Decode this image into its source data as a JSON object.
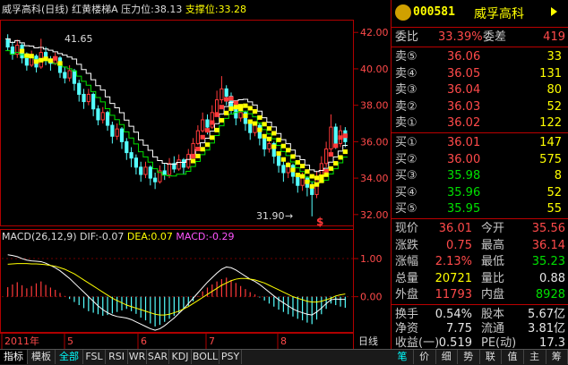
{
  "stock": {
    "name": "威孚高科",
    "period": "日线",
    "indicator_name": "红黄楼梯A",
    "pressure_label": "压力位",
    "pressure_value": "38.13",
    "support_label": "支撑位",
    "support_value": "33.28",
    "code": "000581",
    "title_name": "威孚高科"
  },
  "chart_data": {
    "type": "candlestick",
    "price_axis_ticks": [
      "42.00",
      "40.00",
      "38.00",
      "36.00",
      "34.00",
      "32.00"
    ],
    "ylim": [
      31.5,
      42.6
    ],
    "high_label": "41.65",
    "low_label": "31.90",
    "low_label_arrow": "→",
    "x_labels": [
      "2011年",
      "5",
      "6",
      "7",
      "8"
    ],
    "period_label": "日线",
    "candles": [
      [
        41.6,
        41.2,
        41.9,
        41.0
      ],
      [
        41.2,
        40.8,
        41.5,
        40.5
      ],
      [
        40.8,
        41.3,
        41.6,
        40.6
      ],
      [
        41.3,
        40.6,
        41.4,
        40.3
      ],
      [
        40.6,
        40.2,
        40.9,
        39.9
      ],
      [
        40.2,
        40.7,
        41.0,
        40.1
      ],
      [
        40.7,
        40.1,
        40.8,
        39.8
      ],
      [
        40.1,
        40.9,
        41.65,
        40.0
      ],
      [
        40.9,
        40.5,
        41.2,
        40.2
      ],
      [
        40.5,
        40.3,
        40.7,
        39.9
      ],
      [
        40.3,
        40.6,
        40.9,
        40.2
      ],
      [
        40.6,
        39.8,
        40.7,
        39.5
      ],
      [
        39.8,
        39.5,
        40.1,
        39.2
      ],
      [
        39.5,
        39.9,
        40.2,
        39.3
      ],
      [
        39.9,
        39.2,
        40.0,
        38.8
      ],
      [
        39.2,
        38.6,
        39.4,
        38.2
      ],
      [
        38.6,
        38.2,
        38.9,
        37.8
      ],
      [
        38.2,
        38.6,
        38.9,
        38.0
      ],
      [
        38.6,
        37.8,
        38.7,
        37.4
      ],
      [
        37.8,
        37.2,
        38.0,
        36.9
      ],
      [
        37.2,
        37.6,
        37.9,
        37.0
      ],
      [
        37.6,
        36.9,
        37.7,
        36.6
      ],
      [
        36.9,
        36.3,
        37.1,
        35.9
      ],
      [
        36.3,
        36.7,
        37.0,
        36.1
      ],
      [
        36.7,
        36.0,
        36.8,
        35.6
      ],
      [
        36.0,
        35.4,
        36.2,
        35.0
      ],
      [
        35.4,
        35.1,
        35.7,
        34.6
      ],
      [
        35.1,
        34.6,
        35.3,
        34.2
      ],
      [
        34.6,
        34.2,
        34.9,
        33.8
      ],
      [
        34.2,
        34.6,
        34.9,
        34.0
      ],
      [
        34.6,
        34.0,
        34.7,
        33.6
      ],
      [
        34.0,
        33.8,
        34.3,
        33.4
      ],
      [
        33.8,
        34.4,
        34.7,
        33.7
      ],
      [
        34.4,
        34.2,
        34.8,
        33.9
      ],
      [
        34.2,
        34.8,
        35.1,
        34.0
      ],
      [
        34.8,
        34.5,
        35.2,
        34.3
      ],
      [
        34.5,
        35.0,
        35.3,
        34.4
      ],
      [
        35.0,
        34.6,
        35.1,
        34.2
      ],
      [
        34.6,
        35.3,
        35.6,
        34.5
      ],
      [
        35.3,
        35.9,
        36.2,
        35.2
      ],
      [
        35.9,
        36.6,
        36.9,
        35.8
      ],
      [
        36.6,
        37.2,
        37.6,
        36.5
      ],
      [
        37.2,
        36.8,
        37.5,
        36.4
      ],
      [
        36.8,
        37.6,
        38.0,
        36.7
      ],
      [
        37.6,
        38.3,
        38.8,
        37.5
      ],
      [
        38.3,
        38.9,
        39.6,
        38.1
      ],
      [
        38.9,
        38.5,
        39.1,
        38.0
      ],
      [
        38.5,
        37.8,
        38.7,
        37.5
      ],
      [
        37.8,
        37.3,
        38.0,
        36.9
      ],
      [
        37.3,
        37.6,
        37.9,
        37.1
      ],
      [
        37.6,
        37.0,
        37.7,
        36.6
      ],
      [
        37.0,
        36.5,
        37.2,
        36.1
      ],
      [
        36.5,
        36.9,
        37.1,
        36.3
      ],
      [
        36.9,
        36.2,
        37.0,
        35.8
      ],
      [
        36.2,
        35.6,
        36.4,
        35.2
      ],
      [
        35.6,
        35.9,
        36.1,
        35.4
      ],
      [
        35.9,
        35.2,
        36.0,
        34.8
      ],
      [
        35.2,
        34.7,
        35.4,
        34.3
      ],
      [
        34.7,
        34.3,
        35.0,
        33.8
      ],
      [
        34.3,
        34.7,
        34.9,
        34.0
      ],
      [
        34.7,
        34.1,
        34.8,
        33.7
      ],
      [
        34.1,
        33.6,
        34.3,
        33.2
      ],
      [
        33.6,
        34.0,
        34.3,
        33.3
      ],
      [
        34.0,
        33.5,
        34.1,
        33.0
      ],
      [
        33.5,
        33.1,
        33.8,
        31.9
      ],
      [
        33.1,
        34.0,
        34.4,
        32.9
      ],
      [
        34.0,
        34.8,
        35.2,
        33.9
      ],
      [
        34.8,
        35.6,
        36.0,
        34.6
      ],
      [
        35.6,
        36.8,
        37.5,
        35.4
      ],
      [
        36.8,
        35.9,
        37.0,
        35.6
      ],
      [
        35.9,
        36.6,
        36.9,
        35.7
      ],
      [
        36.6,
        36.0,
        36.8,
        35.7
      ]
    ],
    "macd": {
      "title": "MACD(26,12,9)",
      "dif_label": "DIF:",
      "dif_value": "-0.07",
      "dea_label": "DEA:",
      "dea_value": "0.07",
      "macd_label": "MACD:",
      "macd_value": "-0.29",
      "axis_ticks": [
        "1.00",
        "0.00"
      ],
      "ylim": [
        -0.9,
        1.4
      ],
      "bars": [
        0.25,
        0.32,
        0.38,
        0.3,
        0.22,
        0.28,
        0.35,
        0.4,
        0.31,
        0.24,
        0.18,
        0.1,
        0.02,
        -0.06,
        -0.14,
        -0.22,
        -0.3,
        -0.38,
        -0.42,
        -0.46,
        -0.5,
        -0.48,
        -0.44,
        -0.4,
        -0.36,
        -0.32,
        -0.38,
        -0.45,
        -0.55,
        -0.62,
        -0.7,
        -0.78,
        -0.74,
        -0.66,
        -0.58,
        -0.5,
        -0.42,
        -0.34,
        -0.24,
        -0.12,
        0.02,
        0.14,
        0.24,
        0.32,
        0.4,
        0.46,
        0.5,
        0.44,
        0.36,
        0.28,
        0.2,
        0.12,
        0.06,
        -0.02,
        -0.1,
        -0.18,
        -0.26,
        -0.34,
        -0.4,
        -0.46,
        -0.52,
        -0.58,
        -0.62,
        -0.68,
        -0.72,
        -0.6,
        -0.46,
        -0.32,
        -0.18,
        -0.22,
        -0.26,
        -0.29
      ],
      "dif": [
        1.1,
        1.08,
        1.05,
        1.0,
        0.96,
        0.94,
        0.93,
        0.92,
        0.88,
        0.82,
        0.76,
        0.68,
        0.58,
        0.48,
        0.36,
        0.24,
        0.12,
        0.0,
        -0.12,
        -0.24,
        -0.34,
        -0.42,
        -0.48,
        -0.52,
        -0.54,
        -0.56,
        -0.6,
        -0.66,
        -0.72,
        -0.78,
        -0.84,
        -0.88,
        -0.84,
        -0.76,
        -0.66,
        -0.56,
        -0.44,
        -0.32,
        -0.18,
        -0.04,
        0.1,
        0.24,
        0.38,
        0.5,
        0.62,
        0.72,
        0.78,
        0.76,
        0.7,
        0.62,
        0.54,
        0.46,
        0.4,
        0.32,
        0.22,
        0.12,
        0.02,
        -0.08,
        -0.16,
        -0.24,
        -0.32,
        -0.38,
        -0.42,
        -0.46,
        -0.48,
        -0.4,
        -0.3,
        -0.18,
        -0.08,
        -0.06,
        -0.07,
        -0.07
      ],
      "dea": [
        0.85,
        0.86,
        0.87,
        0.87,
        0.87,
        0.86,
        0.86,
        0.85,
        0.84,
        0.82,
        0.8,
        0.76,
        0.72,
        0.66,
        0.6,
        0.52,
        0.44,
        0.36,
        0.28,
        0.2,
        0.12,
        0.04,
        -0.04,
        -0.1,
        -0.16,
        -0.22,
        -0.26,
        -0.3,
        -0.34,
        -0.38,
        -0.42,
        -0.46,
        -0.48,
        -0.48,
        -0.46,
        -0.42,
        -0.38,
        -0.32,
        -0.26,
        -0.18,
        -0.1,
        -0.02,
        0.06,
        0.14,
        0.22,
        0.3,
        0.36,
        0.42,
        0.46,
        0.48,
        0.48,
        0.46,
        0.44,
        0.4,
        0.36,
        0.3,
        0.24,
        0.18,
        0.12,
        0.06,
        0.0,
        -0.04,
        -0.08,
        -0.12,
        -0.14,
        -0.14,
        -0.12,
        -0.08,
        -0.04,
        0.02,
        0.05,
        0.07
      ]
    }
  },
  "quote": {
    "weibi_label": "委比",
    "weibi_value": "33.39%",
    "weicha_label": "委差",
    "weicha_value": "419",
    "asks": [
      {
        "label": "卖⑤",
        "price": "36.06",
        "vol": "33"
      },
      {
        "label": "卖④",
        "price": "36.05",
        "vol": "131"
      },
      {
        "label": "卖③",
        "price": "36.04",
        "vol": "80"
      },
      {
        "label": "卖②",
        "price": "36.03",
        "vol": "52"
      },
      {
        "label": "卖①",
        "price": "36.02",
        "vol": "122"
      }
    ],
    "bids": [
      {
        "label": "买①",
        "price": "36.01",
        "vol": "147"
      },
      {
        "label": "买②",
        "price": "36.00",
        "vol": "575"
      },
      {
        "label": "买③",
        "price": "35.98",
        "vol": "8"
      },
      {
        "label": "买④",
        "price": "35.96",
        "vol": "52"
      },
      {
        "label": "买⑤",
        "price": "35.95",
        "vol": "55"
      }
    ],
    "stats": [
      {
        "l1": "现价",
        "v1": "36.01",
        "c1": "red",
        "l2": "今开",
        "v2": "35.56",
        "c2": "red"
      },
      {
        "l1": "涨跌",
        "v1": "0.75",
        "c1": "red",
        "l2": "最高",
        "v2": "36.14",
        "c2": "red"
      },
      {
        "l1": "涨幅",
        "v1": "2.13%",
        "c1": "red",
        "l2": "最低",
        "v2": "35.23",
        "c2": "green"
      },
      {
        "l1": "总量",
        "v1": "20721",
        "c1": "yellow",
        "l2": "量比",
        "v2": "0.88",
        "c2": "white"
      },
      {
        "l1": "外盘",
        "v1": "11793",
        "c1": "red",
        "l2": "内盘",
        "v2": "8928",
        "c2": "green"
      }
    ],
    "extra": [
      {
        "l1": "换手",
        "v1": "0.54%",
        "l2": "股本",
        "v2": "5.67亿"
      },
      {
        "l1": "净资",
        "v1": "7.75",
        "l2": "流通",
        "v2": "3.81亿"
      },
      {
        "l1": "收益(一)",
        "v1": "0.519",
        "l2": "PE(动)",
        "v2": "17.3"
      }
    ]
  },
  "tabs_left": [
    "指标",
    "模板",
    "全部",
    "FSL",
    "RSI",
    "WR",
    "SAR",
    "KDJ",
    "BOLL",
    "PSY"
  ],
  "tabs_right": [
    "笔",
    "价",
    "细",
    "势",
    "联",
    "值",
    "主",
    "筹"
  ],
  "colors": {
    "up": "#ff3a3a",
    "down": "#54ffff",
    "accent_red": "#b00000",
    "yellow": "#ffff00",
    "green": "#00e000"
  }
}
